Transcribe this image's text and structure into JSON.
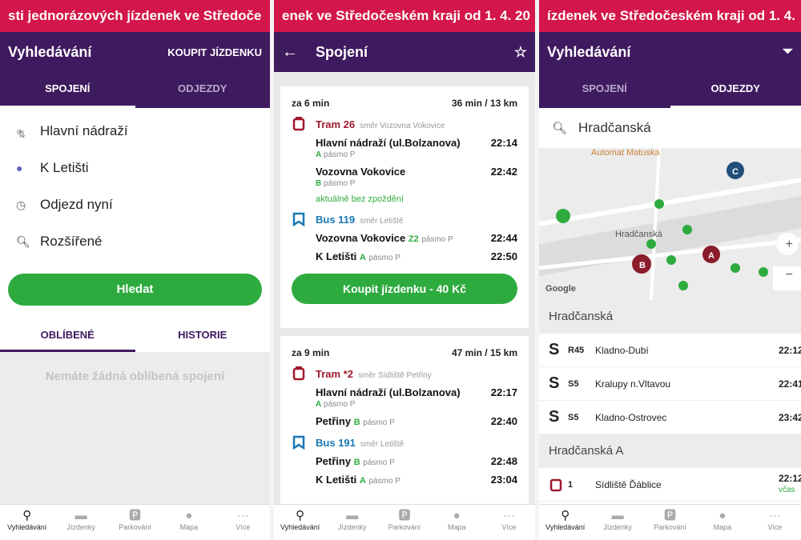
{
  "panel1": {
    "ticker": "sti jednorázových jízdenek ve Středoče",
    "title": "Vyhledávání",
    "action": "KOUPIT JÍZDENKU",
    "tabs": [
      "SPOJENÍ",
      "ODJEZDY"
    ],
    "from": "Hlavní nádraží",
    "to": "K Letišti",
    "time": "Odjezd nyní",
    "advanced": "Rozšířené",
    "search_button": "Hledat",
    "subtabs": [
      "OBLÍBENÉ",
      "HISTORIE"
    ],
    "empty_text": "Nemáte žádná oblíbená spojení"
  },
  "panel2": {
    "ticker": "enek ve Středočeském kraji od 1. 4. 20",
    "title": "Spojení",
    "card1": {
      "in": "za 6 min",
      "duration": "36 min / 13 km",
      "leg1": {
        "line": "Tram 26",
        "dir": "směr Vozovna Vokovice",
        "stop1": "Hlavní nádraží (ul.Bolzanova)",
        "t1": "22:14",
        "z1": "A",
        "z1l": "pásmo P",
        "stop2": "Vozovna Vokovice",
        "t2": "22:42",
        "z2": "B",
        "z2l": "pásmo P",
        "status": "aktuálně bez zpoždění"
      },
      "leg2": {
        "line": "Bus 119",
        "dir": "směr Letiště",
        "stop1": "Vozovna Vokovice",
        "t1": "22:44",
        "z1": "Z2",
        "z1l": "pásmo P",
        "stop2": "K Letišti",
        "t2": "22:50",
        "z2": "A",
        "z2l": "pásmo P"
      },
      "buy": "Koupit jízdenku - 40 Kč"
    },
    "card2": {
      "in": "za 9 min",
      "duration": "47 min / 15 km",
      "leg1": {
        "line": "Tram *2",
        "dir": "směr Sídliště Petřiny",
        "stop1": "Hlavní nádraží (ul.Bolzanova)",
        "t1": "22:17",
        "z1": "A",
        "z1l": "pásmo P",
        "stop2": "Petřiny",
        "t2": "22:40",
        "z2": "B",
        "z2l": "pásmo P"
      },
      "leg2": {
        "line": "Bus 191",
        "dir": "směr Letiště",
        "stop1": "Petřiny",
        "t1": "22:48",
        "z1": "B",
        "z1l": "pásmo P",
        "stop2": "K Letišti",
        "t2": "23:04",
        "z2": "A",
        "z2l": "pásmo P"
      }
    }
  },
  "panel3": {
    "ticker": "ízdenek ve Středočeském kraji od 1. 4.",
    "title": "Vyhledávání",
    "tabs": [
      "SPOJENÍ",
      "ODJEZDY"
    ],
    "search": "Hradčanská",
    "map": {
      "label_top": "Automat Matuska",
      "label_mid": "Hradčanská",
      "google": "Google"
    },
    "sections": [
      {
        "title": "Hradčanská",
        "rows": [
          {
            "line": "R45",
            "dest": "Kladno-Dubí",
            "time": "22:12"
          },
          {
            "line": "S5",
            "dest": "Kralupy n.Vltavou",
            "time": "22:41"
          },
          {
            "line": "S5",
            "dest": "Kladno-Ostrovec",
            "time": "23:42"
          }
        ]
      },
      {
        "title": "Hradčanská A",
        "rows": [
          {
            "line": "1",
            "dest": "Sídliště Ďáblice",
            "time": "22:12",
            "status": "včas"
          }
        ]
      }
    ]
  },
  "nav": [
    "Vyhledávání",
    "Jízdenky",
    "Parkování",
    "Mapa",
    "Více"
  ],
  "colors": {
    "brand": "#3e1a5f",
    "accent": "#d3164b",
    "green": "#2eab3f"
  }
}
